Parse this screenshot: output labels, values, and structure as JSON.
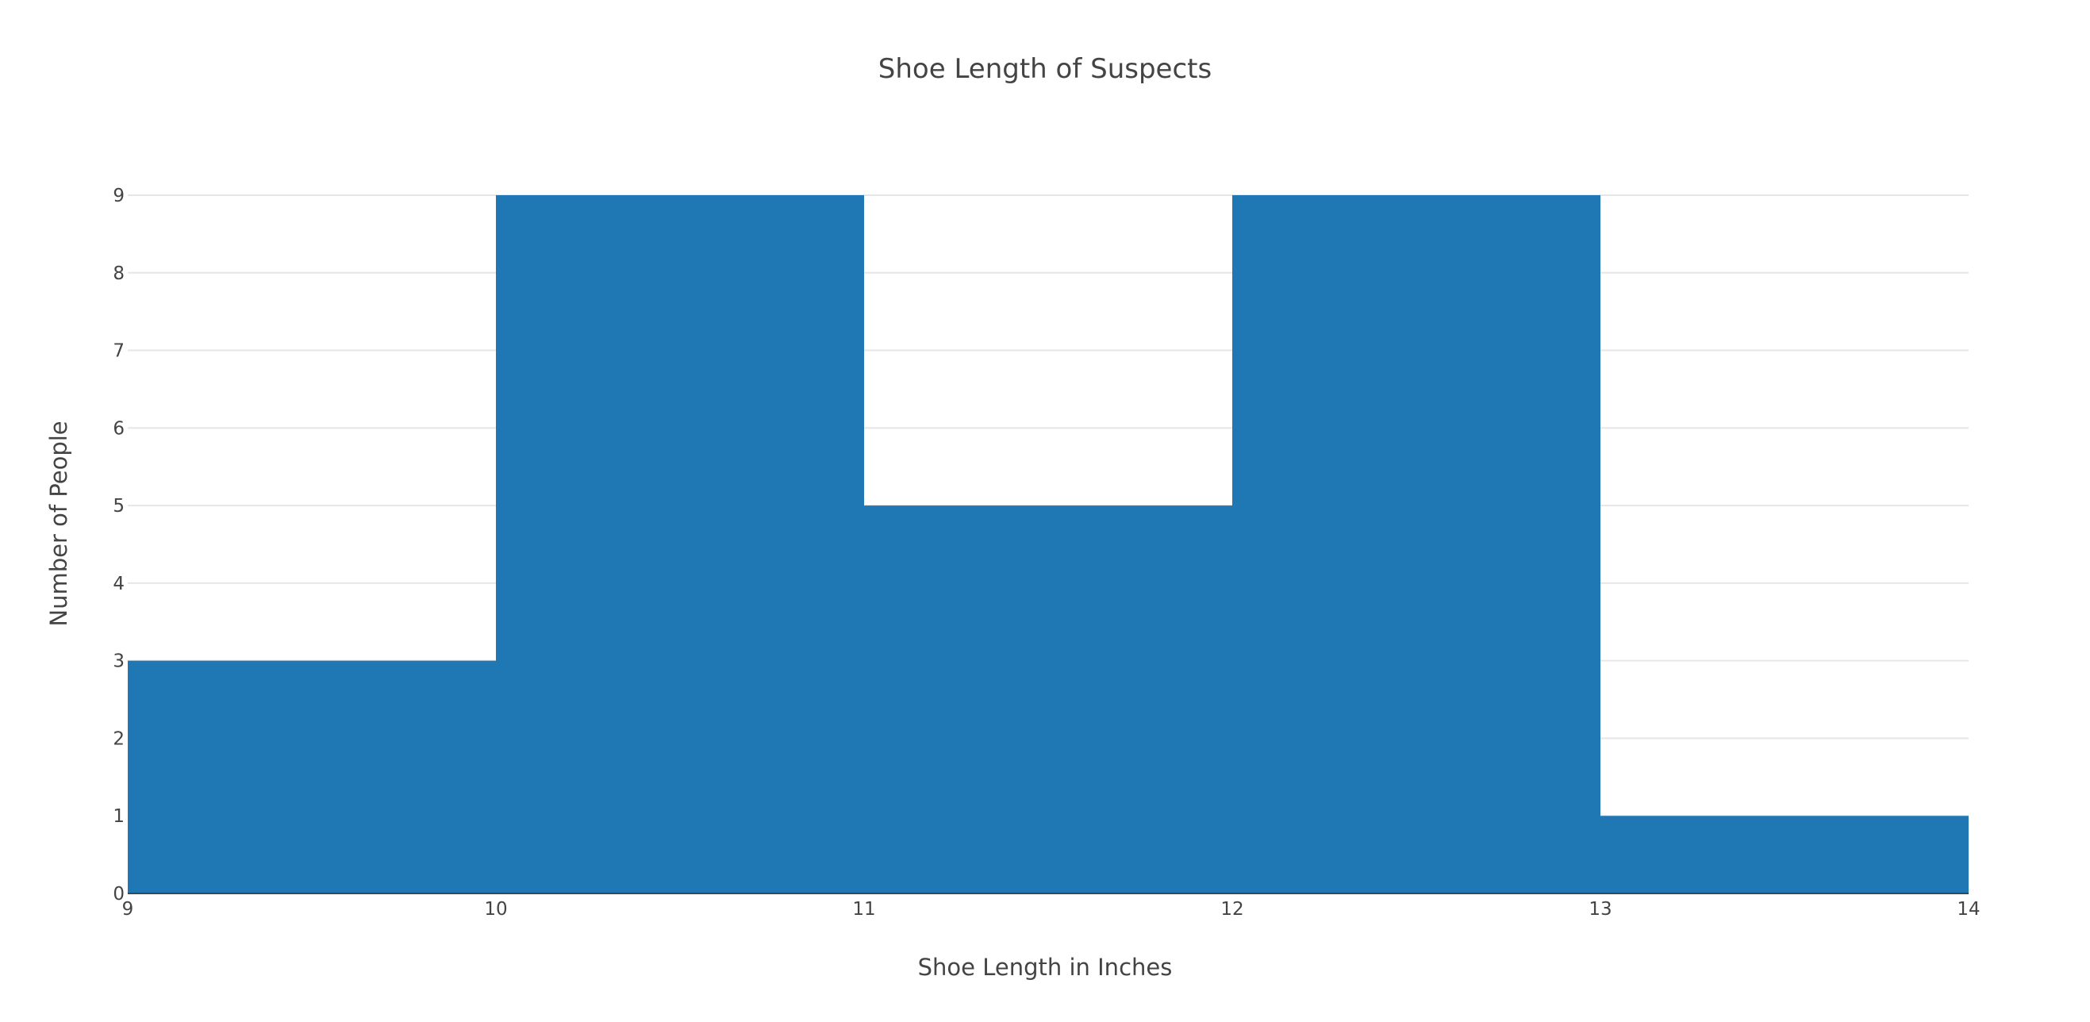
{
  "chart_data": {
    "type": "bar",
    "title": "Shoe Length of Suspects",
    "xlabel": "Shoe Length in Inches",
    "ylabel": "Number of People",
    "bins": [
      {
        "start": 9,
        "end": 10,
        "count": 3
      },
      {
        "start": 10,
        "end": 11,
        "count": 9
      },
      {
        "start": 11,
        "end": 12,
        "count": 5
      },
      {
        "start": 12,
        "end": 13,
        "count": 9
      },
      {
        "start": 13,
        "end": 14,
        "count": 1
      }
    ],
    "xlim": [
      9,
      14
    ],
    "ylim": [
      0,
      9
    ],
    "x_ticks": [
      9,
      10,
      11,
      12,
      13,
      14
    ],
    "y_ticks": [
      0,
      1,
      2,
      3,
      4,
      5,
      6,
      7,
      8,
      9
    ],
    "grid": true,
    "legend": "none",
    "bar_color": "#1f77b4"
  }
}
